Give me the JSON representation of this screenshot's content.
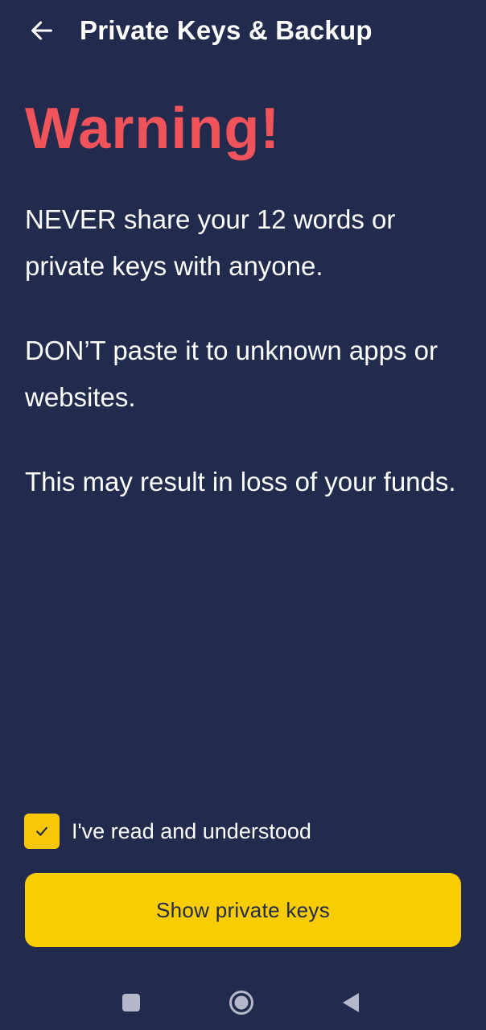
{
  "header": {
    "title": "Private Keys & Backup",
    "back_icon": "arrow-left-icon"
  },
  "warning": {
    "title": "Warning!",
    "color": "#f0535a",
    "messages": [
      "NEVER share your 12 words or private keys with anyone.",
      "DON’T paste it to unknown apps or websites.",
      "This may result in loss of your funds."
    ]
  },
  "acknowledge": {
    "label": "I've read and understood",
    "checked": true,
    "check_icon": "check-icon",
    "checkbox_color": "#f8c808"
  },
  "primary_button": {
    "label": "Show private keys",
    "background": "#facc04",
    "text_color": "#222b4d"
  },
  "system_nav": {
    "recents_icon": "square-icon",
    "home_icon": "circle-icon",
    "back_icon": "triangle-back-icon"
  },
  "colors": {
    "background": "#222b4d",
    "text": "#ffffff",
    "nav_icon": "#b4b8c8"
  }
}
